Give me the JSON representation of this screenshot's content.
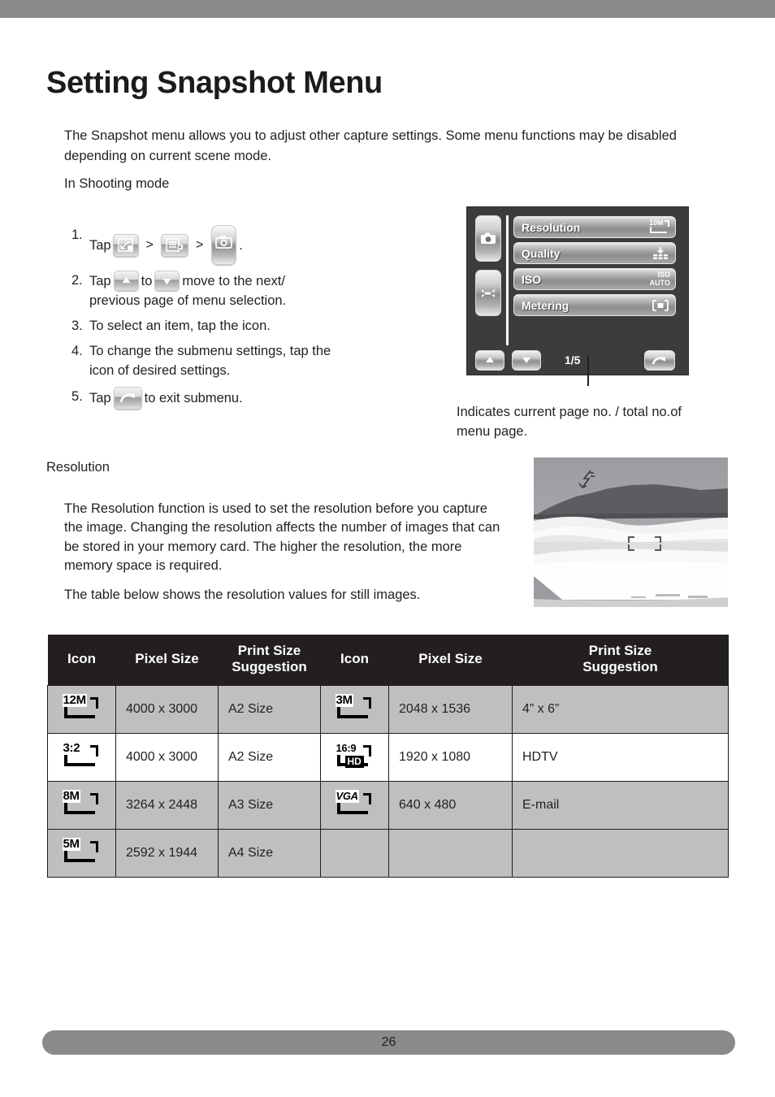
{
  "page": {
    "title": "Setting Snapshot Menu",
    "footer_page_number": "26"
  },
  "intro": {
    "paragraph": "The Snapshot menu allows you to adjust other capture settings. Some menu functions may be disabled depending on current scene mode.",
    "mode_label": "In Shooting mode"
  },
  "steps": [
    {
      "num": "1.",
      "lead": "Tap",
      "sep1": ">",
      "sep2": ">",
      "tail": ".",
      "icons": [
        "resize-icon",
        "menu-list-icon",
        "camera-tab-icon"
      ]
    },
    {
      "num": "2.",
      "lead": "Tap",
      "mid": "to",
      "tail": "move to the next/",
      "line2": "previous page of menu selection.",
      "icons": [
        "arrow-up-icon",
        "arrow-down-icon"
      ]
    },
    {
      "num": "3.",
      "text": "To select an item, tap the icon."
    },
    {
      "num": "4.",
      "text": "To change the submenu settings, tap the",
      "line2": "icon of desired settings."
    },
    {
      "num": "5.",
      "lead": "Tap",
      "tail": "to exit submenu.",
      "icons": [
        "exit-arrow-icon"
      ]
    }
  ],
  "lcd": {
    "tabs": [
      {
        "name": "camera-tab",
        "icon": "camera-icon"
      },
      {
        "name": "wrench-tab",
        "icon": "wrench-icon"
      }
    ],
    "rows": [
      {
        "label": "Resolution",
        "value_icon": "10M",
        "icon_type": "resolution"
      },
      {
        "label": "Quality",
        "value_icon": "",
        "icon_type": "quality"
      },
      {
        "label": "ISO",
        "value_icon": "ISO AUTO",
        "icon_type": "iso"
      },
      {
        "label": "Metering",
        "value_icon": "",
        "icon_type": "metering"
      }
    ],
    "nav": {
      "up": "arrow-up-icon",
      "down": "arrow-down-icon",
      "page_indicator": "1/5",
      "exit": "exit-arrow-icon"
    },
    "caption": "Indicates current page no. / total no.of menu page."
  },
  "resolution_section": {
    "heading": "Resolution",
    "paragraph1": "The Resolution function is used to set the resolution before you capture the image. Changing the resolution affects the number of images that can be stored in your memory card. The higher the resolution, the more memory space is required.",
    "paragraph2": "The table below shows the resolution values for still images."
  },
  "photo": {
    "name": "desert-dunes-photo",
    "overlay_icons": [
      "flash-icon",
      "focus-frame-icon"
    ]
  },
  "table": {
    "headers": [
      "Icon",
      "Pixel Size",
      "Print Size Suggestion",
      "Icon",
      "Pixel Size",
      "Print Size Suggestion"
    ],
    "header_line1": [
      "Icon",
      "Pixel Size",
      "Print Size",
      "Icon",
      "Pixel Size",
      "Print Size"
    ],
    "header_line2": [
      "",
      "",
      "Suggestion",
      "",
      "",
      "Suggestion"
    ],
    "rows": [
      {
        "shaded": true,
        "icon_left": "12M",
        "pixel_left": "4000 x 3000",
        "print_left": "A2 Size",
        "icon_right": "3M",
        "pixel_right": "2048 x 1536",
        "print_right": "4” x 6”"
      },
      {
        "shaded": false,
        "icon_left": "3:2",
        "pixel_left": "4000 x 3000",
        "print_left": "A2 Size",
        "icon_right": "16:9",
        "icon_right_badge": "HD",
        "pixel_right": "1920 x 1080",
        "print_right": "HDTV"
      },
      {
        "shaded": true,
        "icon_left": "8M",
        "pixel_left": "3264 x 2448",
        "print_left": "A3 Size",
        "icon_right": "VGA",
        "pixel_right": "640 x 480",
        "print_right": "E-mail"
      },
      {
        "shaded": true,
        "icon_left": "5M",
        "pixel_left": "2592 x 1944",
        "print_left": "A4 Size",
        "icon_right": "",
        "pixel_right": "",
        "print_right": ""
      }
    ]
  },
  "colors": {
    "header_bg": "#231f20",
    "shaded_row": "#bfbfbf",
    "bar_grey": "#8a8a8d",
    "lcd_bg": "#3c3c3c"
  }
}
